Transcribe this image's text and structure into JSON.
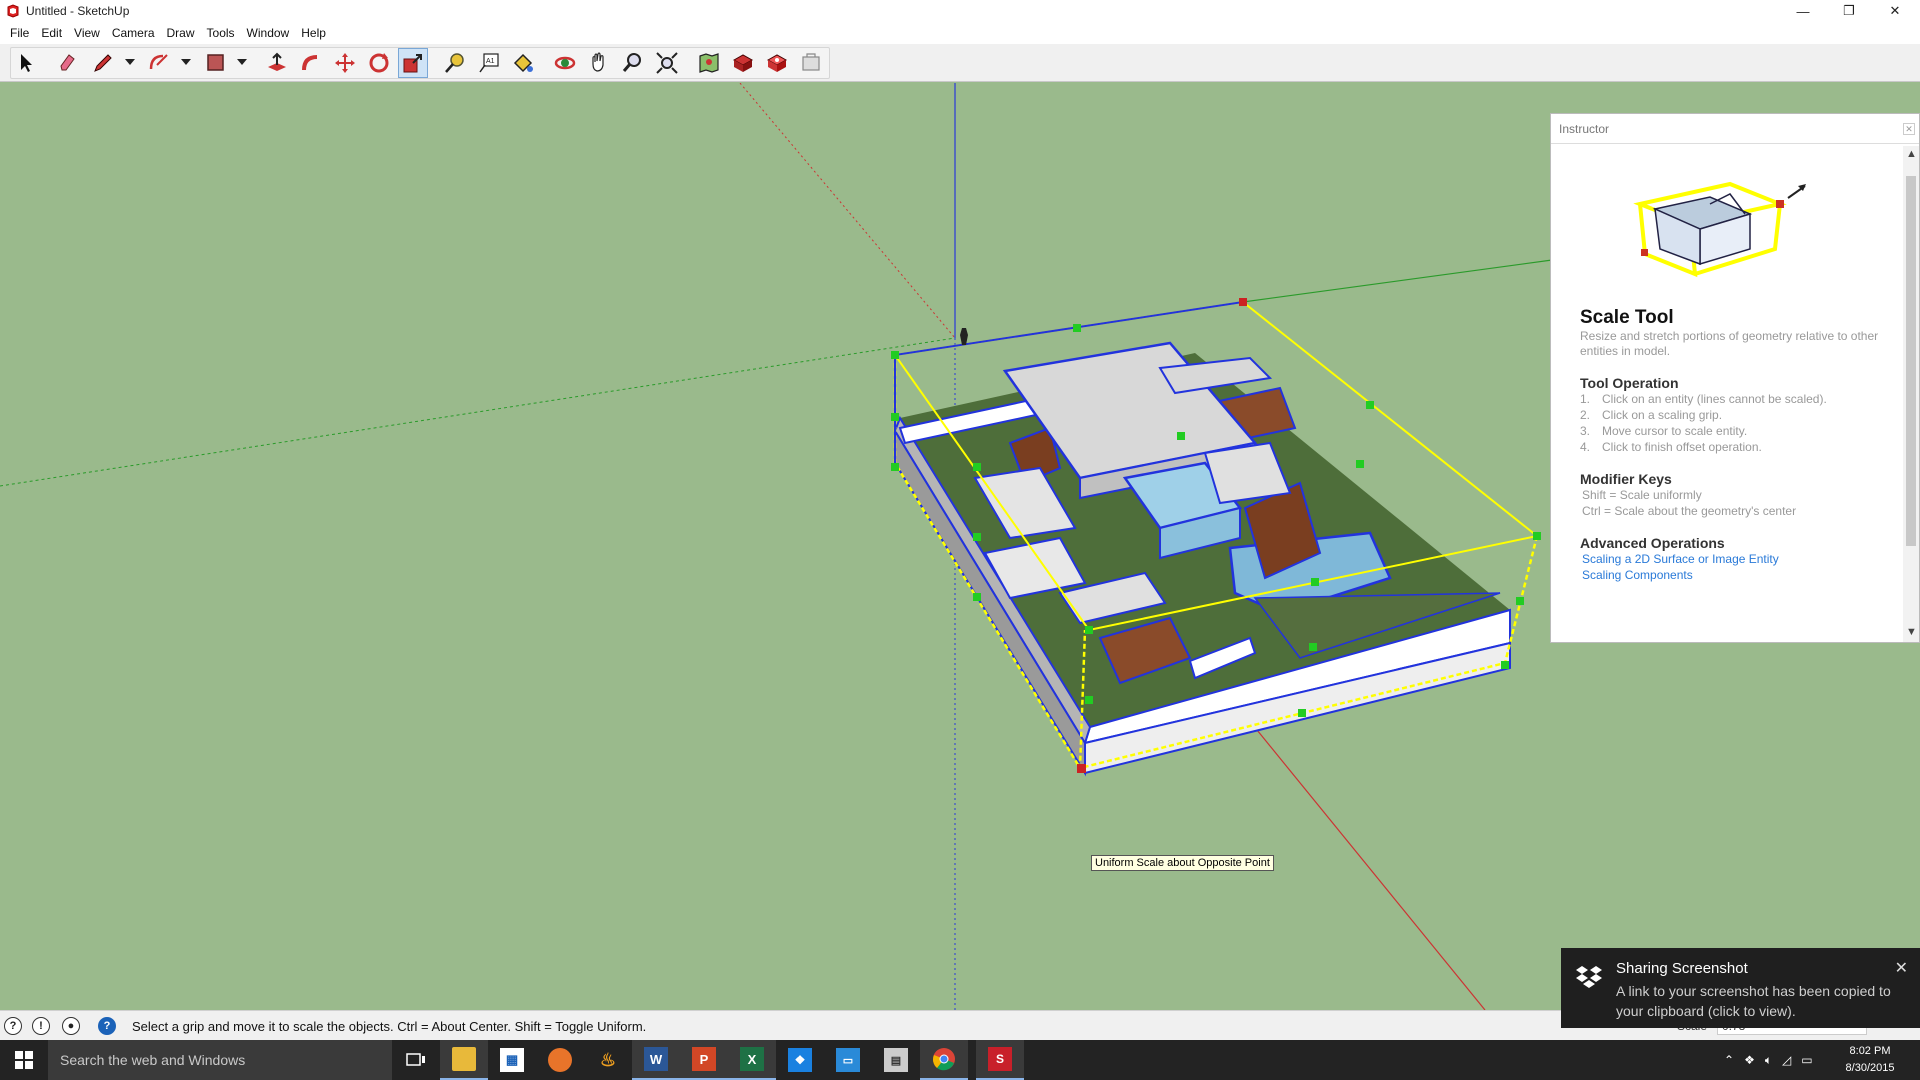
{
  "window": {
    "title": "Untitled - SketchUp",
    "minimize": "—",
    "restore": "❐",
    "close": "✕"
  },
  "menu": [
    "File",
    "Edit",
    "View",
    "Camera",
    "Draw",
    "Tools",
    "Window",
    "Help"
  ],
  "toolbar": {
    "tools": [
      "select-tool",
      "eraser-tool",
      "line-tool",
      "arc-tool",
      "rectangle-tool",
      "push-pull-tool",
      "follow-me-tool",
      "move-tool",
      "rotate-tool",
      "scale-tool",
      "tape-measure-tool",
      "text-tool",
      "paint-bucket-tool",
      "orbit-tool",
      "pan-tool",
      "zoom-tool",
      "zoom-extents-tool",
      "3d-warehouse-tool",
      "extension-warehouse-tool",
      "layout-send-tool",
      "extension-manager-tool"
    ],
    "active_tool": "scale-tool"
  },
  "viewport": {
    "tooltip": "Uniform Scale about Opposite Point",
    "colors": {
      "background": "#9aba8c",
      "bounding_box": "#ffff00",
      "selection": "#0000ff",
      "grip": "#22cc22",
      "active_grip": "#cc2222"
    }
  },
  "instructor": {
    "header": "Instructor",
    "title": "Scale Tool",
    "description": "Resize and stretch portions of geometry relative to other entities in model.",
    "operation_heading": "Tool Operation",
    "operation_steps": [
      {
        "num": "1.",
        "text": "Click on an entity (lines cannot be scaled)."
      },
      {
        "num": "2.",
        "text": "Click on a scaling grip."
      },
      {
        "num": "3.",
        "text": "Move cursor to scale entity."
      },
      {
        "num": "4.",
        "text": "Click to finish offset operation."
      }
    ],
    "modifier_heading": "Modifier Keys",
    "modifier_shift": "Shift = Scale uniformly",
    "modifier_ctrl": "Ctrl = Scale about the geometry's center",
    "advanced_heading": "Advanced Operations",
    "advanced_links": [
      "Scaling a 2D Surface or Image Entity",
      "Scaling Components"
    ]
  },
  "statusbar": {
    "message": "Select a grip and move it to scale the objects. Ctrl = About Center. Shift = Toggle Uniform.",
    "measure_label": "Scale",
    "measure_value": "0.78"
  },
  "toast": {
    "title": "Sharing Screenshot",
    "body": "A link to your screenshot has been copied to your clipboard (click to view).",
    "close": "✕"
  },
  "taskbar": {
    "search_placeholder": "Search the web and Windows",
    "apps": [
      "task-view",
      "file-explorer",
      "store",
      "firefox",
      "app-orange",
      "word",
      "powerpoint",
      "excel",
      "dropbox",
      "remote-desktop",
      "app-grey",
      "chrome",
      "sketchup"
    ],
    "clock_time": "8:02 PM",
    "clock_date": "8/30/2015"
  }
}
